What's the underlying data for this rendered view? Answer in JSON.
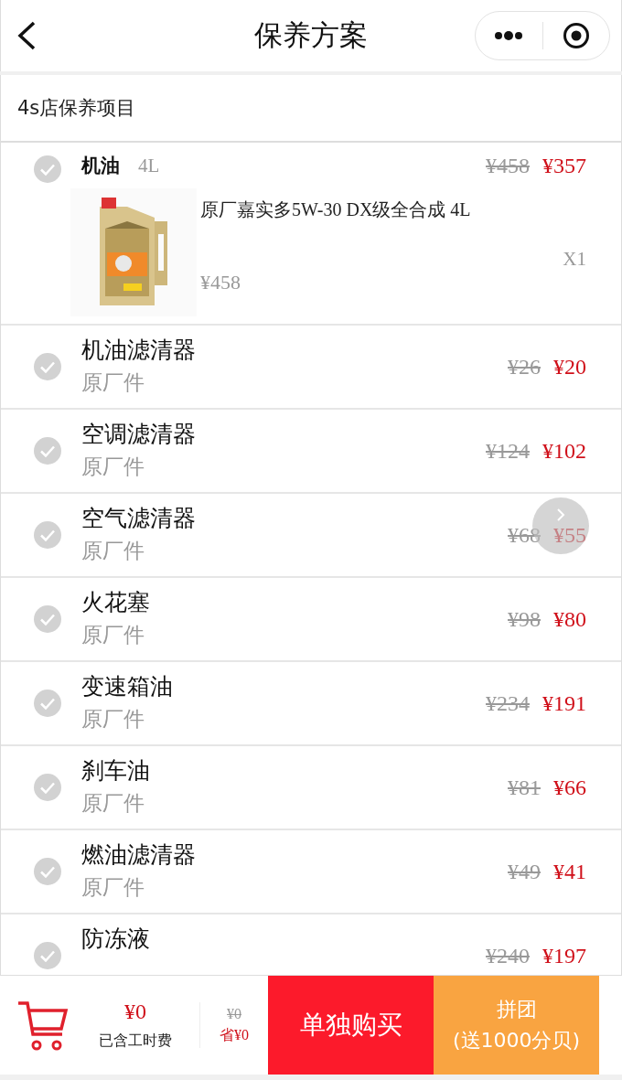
{
  "header": {
    "title": "保养方案"
  },
  "section": {
    "title": "4s店保养项目"
  },
  "main_item": {
    "name": "机油",
    "spec": "4L",
    "old_price": "¥458",
    "price": "¥357",
    "checked": false,
    "product": {
      "name": "原厂嘉实多5W-30 DX级全合成 4L",
      "quantity": "X1",
      "price": "¥458"
    }
  },
  "items": [
    {
      "name": "机油滤清器",
      "sub": "原厂件",
      "old_price": "¥26",
      "price": "¥20",
      "checked": false
    },
    {
      "name": "空调滤清器",
      "sub": "原厂件",
      "old_price": "¥124",
      "price": "¥102",
      "checked": false
    },
    {
      "name": "空气滤清器",
      "sub": "原厂件",
      "old_price": "¥68",
      "price": "¥55",
      "checked": false
    },
    {
      "name": "火花塞",
      "sub": "原厂件",
      "old_price": "¥98",
      "price": "¥80",
      "checked": false
    },
    {
      "name": "变速箱油",
      "sub": "原厂件",
      "old_price": "¥234",
      "price": "¥191",
      "checked": false
    },
    {
      "name": "刹车油",
      "sub": "原厂件",
      "old_price": "¥81",
      "price": "¥66",
      "checked": false
    },
    {
      "name": "燃油滤清器",
      "sub": "原厂件",
      "old_price": "¥49",
      "price": "¥41",
      "checked": false
    },
    {
      "name": "防冻液",
      "old_price": "¥240",
      "price": "¥197",
      "checked": false
    }
  ],
  "footer": {
    "total": "¥0",
    "note": "已含工时费",
    "old_total": "¥0",
    "saved": "省¥0",
    "buy_alone": "单独购买",
    "group_buy": "拼团",
    "group_bonus": "(送1000分贝)"
  }
}
